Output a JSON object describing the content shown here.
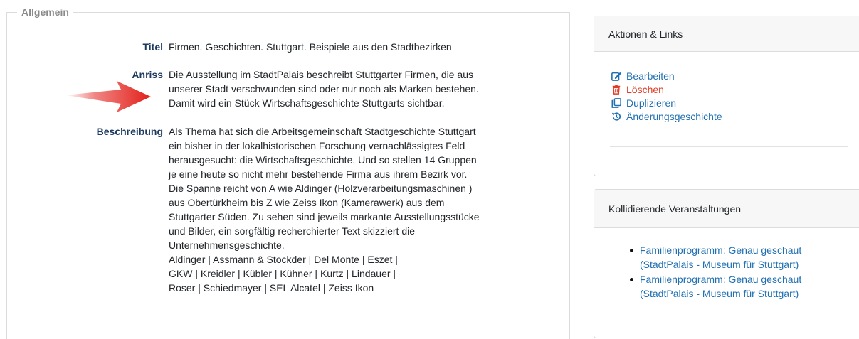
{
  "section": {
    "legend": "Allgemein",
    "titel_label": "Titel",
    "titel_value": "Firmen. Geschichten. Stuttgart. Beispiele aus den Stadtbezirken",
    "anriss_label": "Anriss",
    "anriss_lines": [
      "Die Ausstellung im StadtPalais beschreibt Stuttgarter Firmen, die aus",
      "unserer Stadt verschwunden sind oder nur noch als Marken bestehen.",
      "Damit wird ein Stück Wirtschaftsgeschichte Stuttgarts sichtbar."
    ],
    "beschreibung_label": "Beschreibung",
    "beschreibung_lines": [
      "Als Thema hat sich die Arbeitsgemeinschaft Stadtgeschichte Stuttgart",
      "ein bisher in der lokalhistorischen Forschung vernachlässigtes Feld",
      "herausgesucht: die Wirtschaftsgeschichte. Und so stellen 14 Gruppen",
      "je eine heute so nicht mehr bestehende Firma aus ihrem Bezirk vor.",
      "Die Spanne reicht von A wie Aldinger (Holzverarbeitungsmaschinen )",
      "aus Obertürkheim bis Z wie Zeiss Ikon (Kamerawerk) aus dem",
      "Stuttgarter Süden. Zu sehen sind jeweils markante Ausstellungsstücke",
      "und Bilder, ein sorgfältig recherchierter Text skizziert die",
      "Unternehmensgeschichte.",
      "Aldinger | Assmann & Stockder | Del Monte | Eszet |",
      "GKW | Kreidler | Kübler | Kühner | Kurtz | Lindauer |",
      "Roser | Schiedmayer | SEL Alcatel | Zeiss Ikon"
    ]
  },
  "actions_card": {
    "header": "Aktionen & Links",
    "items": [
      {
        "label": "Bearbeiten",
        "icon": "edit-icon",
        "color": "#1f6fb2"
      },
      {
        "label": "Löschen",
        "icon": "trash-icon",
        "color": "#e03b24"
      },
      {
        "label": "Duplizieren",
        "icon": "copy-icon",
        "color": "#1f6fb2"
      },
      {
        "label": "Änderungsgeschichte",
        "icon": "history-icon",
        "color": "#1f6fb2"
      }
    ]
  },
  "collisions_card": {
    "header": "Kollidierende Veranstaltungen",
    "items": [
      {
        "line1": "Familienprogramm: Genau geschaut",
        "line2": "(StadtPalais - Museum für Stuttgart)"
      },
      {
        "line1": "Familienprogramm: Genau geschaut",
        "line2": "(StadtPalais - Museum für Stuttgart)"
      }
    ]
  },
  "colors": {
    "label": "#1f3a5f",
    "link": "#1f6fb2",
    "danger": "#e03b24",
    "arrow": "#e3201b"
  }
}
